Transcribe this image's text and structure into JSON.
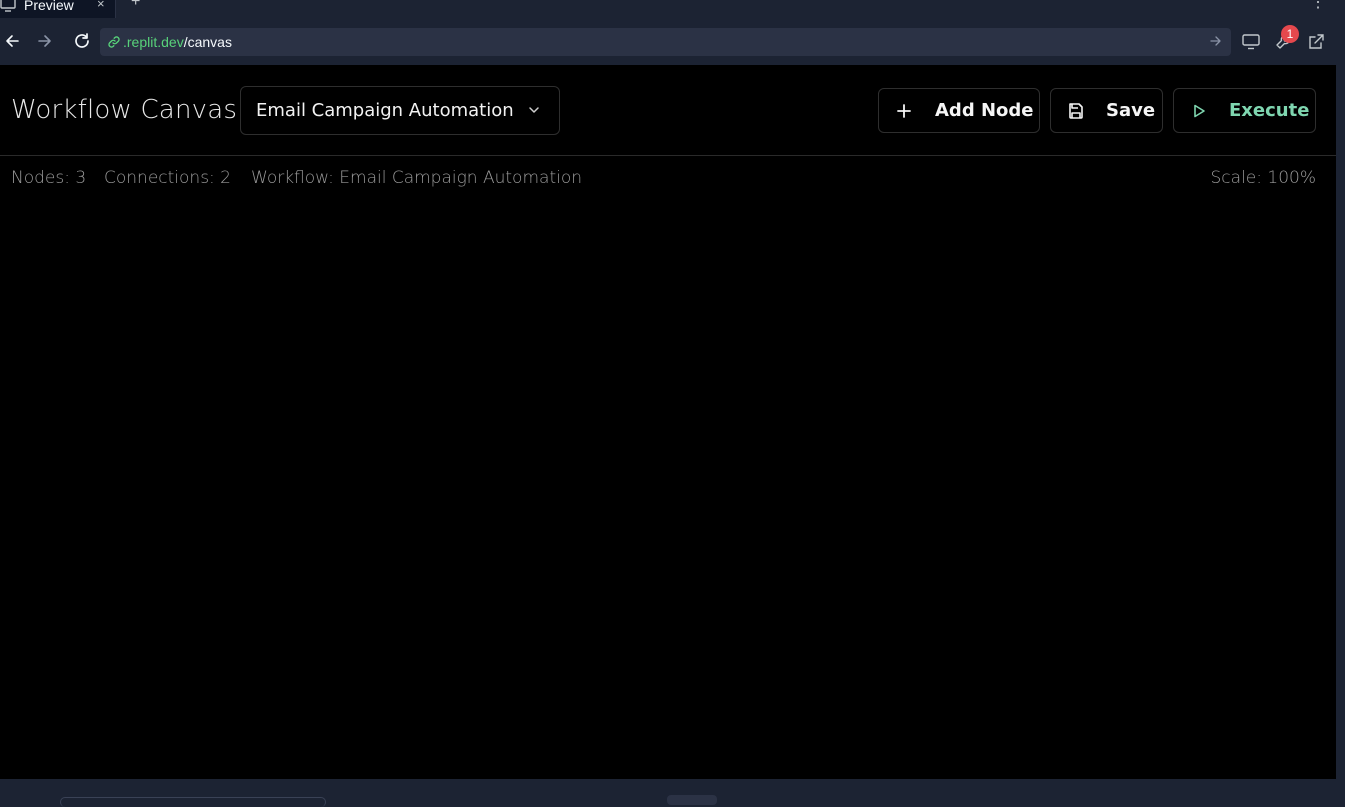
{
  "browser": {
    "tab_label": "Preview",
    "tab_close": "×",
    "new_tab": "+",
    "menu": "⋮",
    "url_domain": ".replit.dev",
    "url_path": "/canvas",
    "notification_count": "1"
  },
  "header": {
    "title": "Workflow Canvas",
    "workflow_select_value": "Email Campaign Automation",
    "buttons": {
      "add_node": "Add Node",
      "save": "Save",
      "execute": "Execute"
    }
  },
  "status": {
    "nodes": "Nodes: 3",
    "connections": "Connections: 2",
    "workflow": "Workflow: Email Campaign Automation",
    "scale": "Scale: 100%"
  },
  "colors": {
    "chrome_bg": "#1c2333",
    "app_bg": "#000000",
    "url_domain": "#58d27a",
    "execute_accent": "#7fd6b0",
    "badge": "#e5484d"
  },
  "icons": [
    "monitor-icon",
    "close-icon",
    "plus-icon",
    "back-arrow-icon",
    "forward-arrow-icon",
    "reload-icon",
    "link-icon",
    "go-arrow-icon",
    "devices-icon",
    "wrench-icon",
    "external-link-icon",
    "chevron-down-icon",
    "save-icon",
    "play-icon"
  ]
}
